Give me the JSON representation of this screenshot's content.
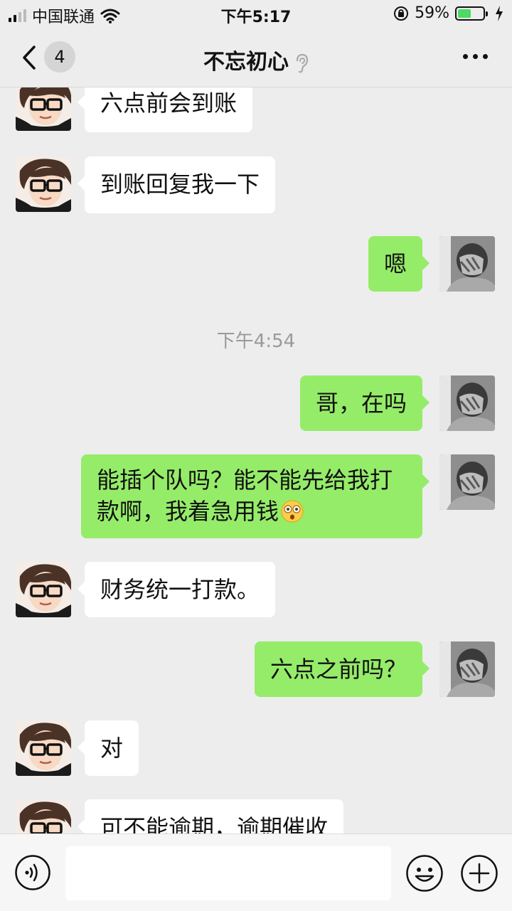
{
  "status_bar": {
    "carrier": "中国联通",
    "time": "下午5:17",
    "battery": "59%",
    "battery_level": 0.59,
    "icons": [
      "signal-icon",
      "wifi-icon",
      "rotation-lock-icon",
      "battery-icon",
      "charging-icon"
    ]
  },
  "nav": {
    "back_icon": "chevron-left-icon",
    "unread_count": "4",
    "title": "不忘初心",
    "title_icon": "ear-icon",
    "more_icon": "more-icon"
  },
  "messages": [
    {
      "side": "left",
      "text": "六点前会到账"
    },
    {
      "side": "left",
      "text": "到账回复我一下"
    },
    {
      "side": "right",
      "text": "嗯"
    },
    {
      "type": "time",
      "text": "下午4:54"
    },
    {
      "side": "right",
      "text": "哥，在吗"
    },
    {
      "side": "right",
      "text": "能插个队吗？能不能先给我打款啊，我着急用钱",
      "emoji": "flushed-emoji"
    },
    {
      "side": "left",
      "text": "财务统一打款。"
    },
    {
      "side": "right",
      "text": "六点之前吗？"
    },
    {
      "side": "left",
      "text": "对"
    },
    {
      "side": "left",
      "text": "可不能逾期，逾期催收"
    }
  ],
  "input_bar": {
    "voice_icon": "voice-icon",
    "input_value": "",
    "emoji_icon": "emoji-icon",
    "plus_icon": "plus-icon"
  },
  "colors": {
    "background": "#ededed",
    "sent_bubble": "#95ec69",
    "received_bubble": "#ffffff",
    "timestamp": "#9a9a9a"
  }
}
